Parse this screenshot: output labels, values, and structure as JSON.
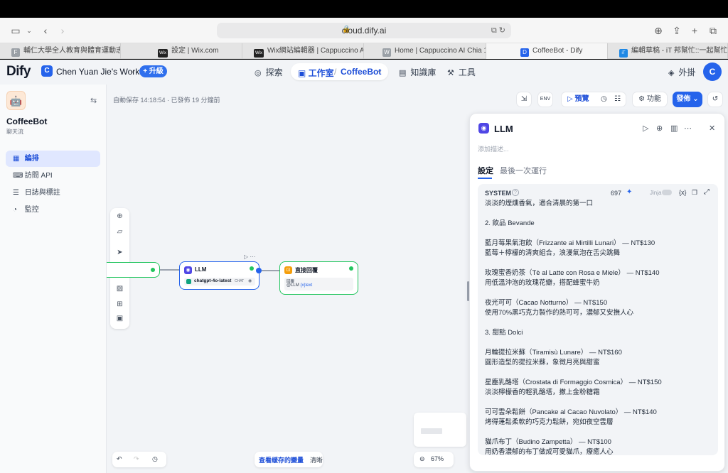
{
  "browser": {
    "url": "cloud.dify.ai",
    "tabs": [
      {
        "label": "輔仁大學全人教育與體育運動志...",
        "fav": "F"
      },
      {
        "label": "設定 | Wix.com",
        "fav": "Wix"
      },
      {
        "label": "Wix網站編輯器 | Cappuccino AI...",
        "fav": "Wix"
      },
      {
        "label": "Home | Cappuccino AI Chia 1",
        "fav": "W"
      },
      {
        "label": "CoffeeBot - Dify",
        "fav": "D"
      },
      {
        "label": "編輯草稿 - iT 邦幫忙::一起幫忙...",
        "fav": "iT"
      }
    ]
  },
  "header": {
    "logo": "Dify",
    "workspace_initial": "C",
    "workspace_name": "Chen Yuan Jie's Work...",
    "upgrade": "升級",
    "nav": {
      "explore": "探索",
      "studio": "工作室",
      "app": "CoffeeBot",
      "knowledge": "知識庫",
      "tools": "工具"
    },
    "plugins": "外掛",
    "user_initial": "C"
  },
  "sidebar": {
    "app_name": "CoffeeBot",
    "app_type": "聊天流",
    "menu": [
      {
        "label": "編排",
        "icon": "orchestrate-icon",
        "active": true
      },
      {
        "label": "訪問 API",
        "icon": "api-icon",
        "active": false
      },
      {
        "label": "日誌與標註",
        "icon": "logs-icon",
        "active": false
      },
      {
        "label": "監控",
        "icon": "monitor-icon",
        "active": false
      }
    ]
  },
  "canvas": {
    "autosave": "自動保存 14:18:54 · 已發佈 19 分鐘前",
    "preview": "預覽",
    "features": "功能",
    "publish": "發佈",
    "llm_node": {
      "title": "LLM",
      "model": "chatgpt-4o-latest",
      "badge": "CHAT"
    },
    "answer_node": {
      "title": "直接回覆",
      "label": "回覆",
      "var": "LLM",
      "var2": "{x}text"
    },
    "bottom": {
      "cached_vars": "查看緩存的變量",
      "clear": "清晰",
      "zoom": "67%"
    }
  },
  "panel": {
    "title": "LLM",
    "desc": "添加描述...",
    "tabs": [
      "設定",
      "最後一次運行"
    ],
    "system_label": "SYSTEM",
    "count": "697",
    "jinja": "Jinja",
    "lines": [
      "淡淡的煙燻香氣，適合清晨的第一口",
      "",
      "2. 飲品 Bevande",
      "",
      "藍月莓果氣泡飲（Frizzante ai Mirtilli Lunari） — NT$130",
      "藍莓＋檸檬的清爽組合，浪漫氣泡在舌尖跳舞",
      "",
      "玫瑰蜜香奶茶（Tè al Latte con Rosa e Miele） — NT$140",
      "用低溫沖泡的玫瑰花瓣，搭配蜂蜜牛奶",
      "",
      "夜光可可（Cacao Notturno） — NT$150",
      "使用70%黑巧克力製作的熱可可，濃郁又安撫人心",
      "",
      "3. 甜點 Dolci",
      "",
      "月輪提拉米蘇（Tiramisù Lunare） — NT$160",
      "圓形造型的提拉米蘇，象徵月亮與甜蜜",
      "",
      "星塵乳酪塔（Crostata di Formaggio Cosmica） — NT$150",
      "淡淡檸檬香的輕乳酪塔，撒上金粉糖霜",
      "",
      "可可雲朵鬆餅（Pancake al Cacao Nuvolato） — NT$140",
      "烤得蓬鬆柔軟的巧克力鬆餅，宛如夜空雲層",
      "",
      "貓爪布丁（Budino Zampetta） — NT$100",
      "用奶香濃郁的布丁做成可愛貓爪，療癒人心"
    ]
  }
}
